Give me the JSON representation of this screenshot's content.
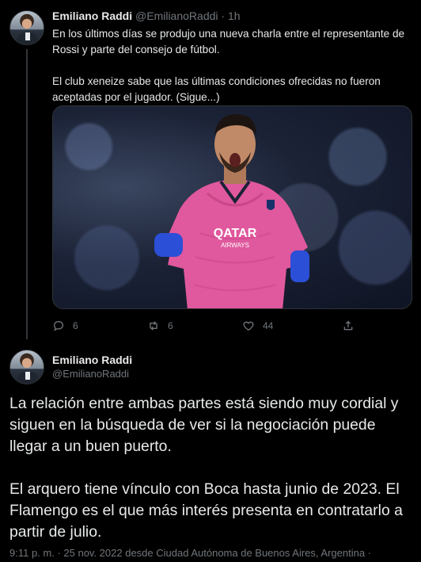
{
  "tweet1": {
    "author_name": "Emiliano Raddi",
    "author_handle": "@EmilianoRaddi",
    "separator": " · ",
    "time": "1h",
    "paragraph1": "En los últimos días se produjo una nueva charla entre el representante de Rossi y parte del consejo de fútbol.",
    "paragraph2": "El club xeneize sabe que las últimas condiciones ofrecidas no fueron aceptadas por el jugador. (Sigue...)",
    "replies": "6",
    "retweets": "6",
    "likes": "44"
  },
  "tweet2": {
    "author_name": "Emiliano Raddi",
    "author_handle": "@EmilianoRaddi",
    "paragraph1": "La relación entre ambas partes está siendo muy cordial y siguen en la búsqueda de ver si la negociación puede llegar a un buen puerto.",
    "paragraph2": "El arquero tiene vínculo con Boca hasta junio de 2023. El Flamengo es el que más interés presenta en contratarlo a partir de julio.",
    "meta": "9:11 p. m. · 25 nov. 2022 desde Ciudad Autónoma de Buenos Aires, Argentina ·"
  },
  "media": {
    "jersey_text_1": "QATAR",
    "jersey_text_2": "AIRWAYS"
  },
  "colors": {
    "background": "#000000",
    "text": "#e7e9ea",
    "secondary": "#71767b",
    "jersey": "#e0589d"
  }
}
